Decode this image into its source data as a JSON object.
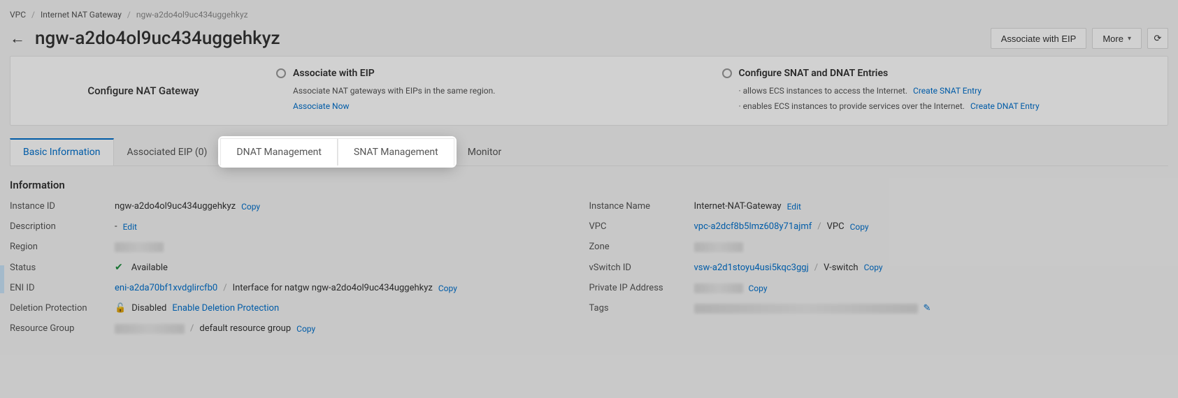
{
  "breadcrumb": {
    "vpc": "VPC",
    "gateway": "Internet NAT Gateway",
    "current": "ngw-a2do4ol9uc434uggehkyz"
  },
  "header": {
    "title": "ngw-a2do4ol9uc434uggehkyz",
    "associate_btn": "Associate with EIP",
    "more_btn": "More"
  },
  "guide": {
    "configure_title": "Configure NAT Gateway",
    "step1_title": "Associate with EIP",
    "step1_desc": "Associate NAT gateways with EIPs in the same region.",
    "step1_link": "Associate Now",
    "step2_title": "Configure SNAT and DNAT Entries",
    "step2_line1": "· allows ECS instances to access the Internet.",
    "step2_link1": "Create SNAT Entry",
    "step2_line2": "· enables ECS instances to provide services over the Internet.",
    "step2_link2": "Create DNAT Entry"
  },
  "tabs": {
    "basic": "Basic Information",
    "eip": "Associated EIP (0)",
    "dnat": "DNAT Management",
    "snat": "SNAT Management",
    "monitor": "Monitor"
  },
  "section_title": "Information",
  "info": {
    "instance_id_lbl": "Instance ID",
    "instance_id_val": "ngw-a2do4ol9uc434uggehkyz",
    "instance_name_lbl": "Instance Name",
    "instance_name_val": "Internet-NAT-Gateway",
    "description_lbl": "Description",
    "description_val": "-",
    "vpc_lbl": "VPC",
    "vpc_link": "vpc-a2dcf8b5lmz608y71ajmf",
    "vpc_name": "VPC",
    "region_lbl": "Region",
    "zone_lbl": "Zone",
    "status_lbl": "Status",
    "status_val": "Available",
    "vswitch_lbl": "vSwitch ID",
    "vswitch_link": "vsw-a2d1stoyu4usi5kqc3ggj",
    "vswitch_name": "V-switch",
    "eni_lbl": "ENI ID",
    "eni_link": "eni-a2da70bf1xvdglircfb0",
    "eni_desc": "Interface for natgw ngw-a2do4ol9uc434uggehkyz",
    "private_ip_lbl": "Private IP Address",
    "deletion_lbl": "Deletion Protection",
    "deletion_val": "Disabled",
    "deletion_link": "Enable Deletion Protection",
    "tags_lbl": "Tags",
    "rg_lbl": "Resource Group",
    "rg_val": "default resource group",
    "copy": "Copy",
    "edit": "Edit"
  }
}
